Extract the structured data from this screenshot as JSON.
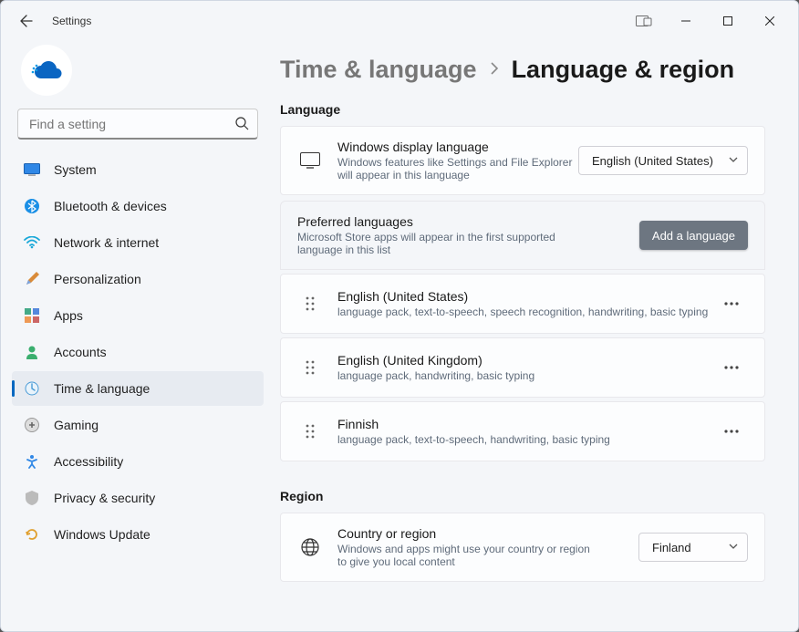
{
  "app": {
    "title": "Settings"
  },
  "search": {
    "placeholder": "Find a setting"
  },
  "nav": {
    "items": [
      {
        "label": "System"
      },
      {
        "label": "Bluetooth & devices"
      },
      {
        "label": "Network & internet"
      },
      {
        "label": "Personalization"
      },
      {
        "label": "Apps"
      },
      {
        "label": "Accounts"
      },
      {
        "label": "Time & language"
      },
      {
        "label": "Gaming"
      },
      {
        "label": "Accessibility"
      },
      {
        "label": "Privacy & security"
      },
      {
        "label": "Windows Update"
      }
    ]
  },
  "breadcrumb": {
    "parent": "Time & language",
    "current": "Language & region"
  },
  "sections": {
    "language_label": "Language",
    "region_label": "Region"
  },
  "display_language": {
    "title": "Windows display language",
    "sub": "Windows features like Settings and File Explorer will appear in this language",
    "value": "English (United States)"
  },
  "preferred": {
    "title": "Preferred languages",
    "sub": "Microsoft Store apps will appear in the first supported language in this list",
    "add_button": "Add a language",
    "items": [
      {
        "name": "English (United States)",
        "meta": "language pack, text-to-speech, speech recognition, handwriting, basic typing"
      },
      {
        "name": "English (United Kingdom)",
        "meta": "language pack, handwriting, basic typing"
      },
      {
        "name": "Finnish",
        "meta": "language pack, text-to-speech, handwriting, basic typing"
      }
    ]
  },
  "region": {
    "title": "Country or region",
    "sub": "Windows and apps might use your country or region to give you local content",
    "value": "Finland"
  }
}
